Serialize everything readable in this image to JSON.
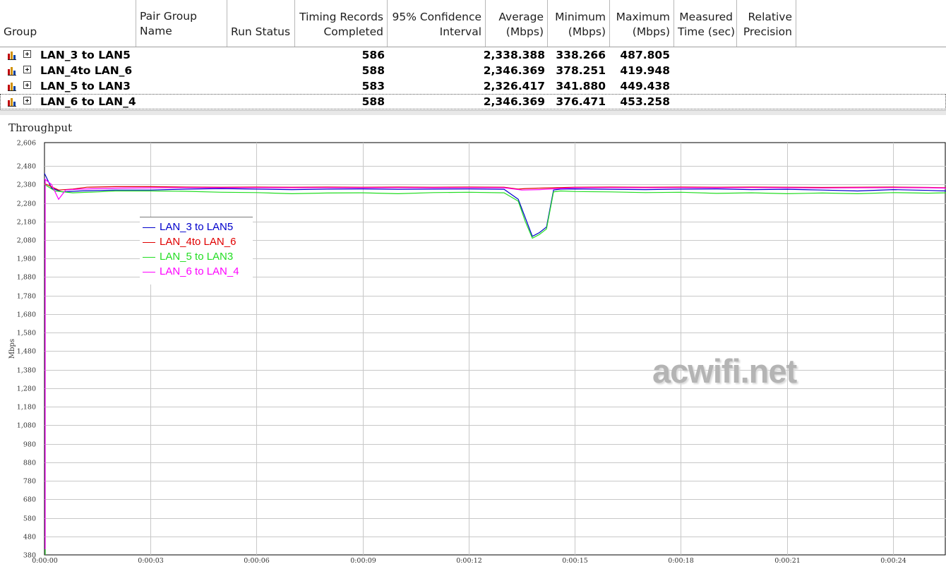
{
  "table": {
    "headers": [
      {
        "key": "group",
        "lines": [
          "Group"
        ]
      },
      {
        "key": "pair_group_name",
        "lines": [
          "Pair Group",
          "Name"
        ]
      },
      {
        "key": "run_status",
        "lines": [
          "Run Status"
        ]
      },
      {
        "key": "timing_records",
        "lines": [
          "Timing Records",
          "Completed"
        ]
      },
      {
        "key": "confidence",
        "lines": [
          "95% Confidence",
          "Interval"
        ]
      },
      {
        "key": "average",
        "lines": [
          "Average",
          "(Mbps)"
        ]
      },
      {
        "key": "minimum",
        "lines": [
          "Minimum",
          "(Mbps)"
        ]
      },
      {
        "key": "maximum",
        "lines": [
          "Maximum",
          "(Mbps)"
        ]
      },
      {
        "key": "measured_time",
        "lines": [
          "Measured",
          "Time (sec)"
        ]
      },
      {
        "key": "relative_precision",
        "lines": [
          "Relative",
          "Precision"
        ]
      }
    ],
    "rows": [
      {
        "group": "LAN_3 to LAN5",
        "records": "586",
        "average": "2,338.388",
        "minimum": "338.266",
        "maximum": "487.805"
      },
      {
        "group": "LAN_4to LAN_6",
        "records": "588",
        "average": "2,346.369",
        "minimum": "378.251",
        "maximum": "419.948"
      },
      {
        "group": "LAN_5 to LAN3",
        "records": "583",
        "average": "2,326.417",
        "minimum": "341.880",
        "maximum": "449.438"
      },
      {
        "group": "LAN_6 to LAN_4",
        "records": "588",
        "average": "2,346.369",
        "minimum": "376.471",
        "maximum": "453.258"
      }
    ]
  },
  "watermark": "acwifi.net",
  "chart_data": {
    "type": "line",
    "title": "Throughput",
    "ylabel": "Mbps",
    "xlabel": "",
    "ylim": [
      380,
      2606
    ],
    "xlim_seconds": [
      0,
      25.5
    ],
    "y_ticks": [
      "2,606",
      "2,480",
      "2,380",
      "2,280",
      "2,180",
      "2,080",
      "1,980",
      "1,880",
      "1,780",
      "1,680",
      "1,580",
      "1,480",
      "1,380",
      "1,280",
      "1,180",
      "1,080",
      "980",
      "880",
      "780",
      "680",
      "580",
      "480",
      "380"
    ],
    "x_ticks": [
      "0:00:00",
      "0:00:03",
      "0:00:06",
      "0:00:09",
      "0:00:12",
      "0:00:15",
      "0:00:18",
      "0:00:21",
      "0:00:24"
    ],
    "grid": true,
    "legend_position": "upper-left",
    "series": [
      {
        "name": "LAN_3 to LAN5",
        "color": "#0000cc",
        "points": [
          [
            0,
            2440
          ],
          [
            0.2,
            2360
          ],
          [
            0.5,
            2340
          ],
          [
            1,
            2345
          ],
          [
            2,
            2350
          ],
          [
            3,
            2350
          ],
          [
            4,
            2355
          ],
          [
            5,
            2358
          ],
          [
            6,
            2355
          ],
          [
            7,
            2352
          ],
          [
            8,
            2355
          ],
          [
            9,
            2356
          ],
          [
            10,
            2354
          ],
          [
            11,
            2355
          ],
          [
            12,
            2356
          ],
          [
            13,
            2354
          ],
          [
            13.4,
            2300
          ],
          [
            13.6,
            2200
          ],
          [
            13.8,
            2100
          ],
          [
            14,
            2120
          ],
          [
            14.2,
            2150
          ],
          [
            14.4,
            2350
          ],
          [
            14.6,
            2355
          ],
          [
            15,
            2356
          ],
          [
            16,
            2354
          ],
          [
            17,
            2352
          ],
          [
            18,
            2355
          ],
          [
            19,
            2356
          ],
          [
            20,
            2352
          ],
          [
            21,
            2354
          ],
          [
            22,
            2350
          ],
          [
            23,
            2345
          ],
          [
            24,
            2352
          ],
          [
            25,
            2348
          ],
          [
            25.5,
            2345
          ]
        ]
      },
      {
        "name": "LAN_4to LAN_6",
        "color": "#e00000",
        "points": [
          [
            0,
            2385
          ],
          [
            0.4,
            2350
          ],
          [
            0.8,
            2355
          ],
          [
            1.2,
            2365
          ],
          [
            2,
            2368
          ],
          [
            3,
            2368
          ],
          [
            4,
            2366
          ],
          [
            5,
            2365
          ],
          [
            6,
            2366
          ],
          [
            7,
            2365
          ],
          [
            8,
            2366
          ],
          [
            9,
            2365
          ],
          [
            10,
            2366
          ],
          [
            11,
            2365
          ],
          [
            12,
            2366
          ],
          [
            13,
            2365
          ],
          [
            13.4,
            2355
          ],
          [
            13.6,
            2358
          ],
          [
            14,
            2360
          ],
          [
            14.4,
            2362
          ],
          [
            15,
            2365
          ],
          [
            16,
            2366
          ],
          [
            17,
            2365
          ],
          [
            18,
            2366
          ],
          [
            19,
            2365
          ],
          [
            20,
            2366
          ],
          [
            21,
            2365
          ],
          [
            22,
            2364
          ],
          [
            23,
            2365
          ],
          [
            24,
            2366
          ],
          [
            25,
            2364
          ],
          [
            25.5,
            2362
          ]
        ]
      },
      {
        "name": "LAN_5 to LAN3",
        "color": "#22dd22",
        "points": [
          [
            0,
            2380
          ],
          [
            0.3,
            2345
          ],
          [
            0.8,
            2335
          ],
          [
            1.5,
            2340
          ],
          [
            2,
            2345
          ],
          [
            3,
            2345
          ],
          [
            4,
            2343
          ],
          [
            5,
            2338
          ],
          [
            6,
            2336
          ],
          [
            7,
            2330
          ],
          [
            8,
            2334
          ],
          [
            9,
            2335
          ],
          [
            10,
            2330
          ],
          [
            11,
            2336
          ],
          [
            12,
            2338
          ],
          [
            13,
            2335
          ],
          [
            13.4,
            2290
          ],
          [
            13.6,
            2180
          ],
          [
            13.8,
            2090
          ],
          [
            14,
            2110
          ],
          [
            14.2,
            2140
          ],
          [
            14.4,
            2340
          ],
          [
            14.6,
            2345
          ],
          [
            15,
            2342
          ],
          [
            16,
            2340
          ],
          [
            17,
            2336
          ],
          [
            18,
            2338
          ],
          [
            19,
            2332
          ],
          [
            20,
            2335
          ],
          [
            21,
            2330
          ],
          [
            22,
            2334
          ],
          [
            23,
            2330
          ],
          [
            24,
            2336
          ],
          [
            25,
            2333
          ],
          [
            25.5,
            2335
          ]
        ]
      },
      {
        "name": "LAN_6 to LAN_4",
        "color": "#ff00ff",
        "points": [
          [
            0,
            2410
          ],
          [
            0.2,
            2380
          ],
          [
            0.4,
            2300
          ],
          [
            0.6,
            2350
          ],
          [
            1,
            2355
          ],
          [
            2,
            2360
          ],
          [
            3,
            2362
          ],
          [
            4,
            2363
          ],
          [
            5,
            2362
          ],
          [
            6,
            2363
          ],
          [
            7,
            2362
          ],
          [
            8,
            2363
          ],
          [
            9,
            2362
          ],
          [
            10,
            2363
          ],
          [
            11,
            2362
          ],
          [
            12,
            2363
          ],
          [
            13,
            2362
          ],
          [
            13.5,
            2350
          ],
          [
            14,
            2352
          ],
          [
            14.5,
            2358
          ],
          [
            15,
            2362
          ],
          [
            16,
            2363
          ],
          [
            17,
            2362
          ],
          [
            18,
            2363
          ],
          [
            19,
            2362
          ],
          [
            20,
            2363
          ],
          [
            21,
            2362
          ],
          [
            22,
            2361
          ],
          [
            23,
            2362
          ],
          [
            24,
            2363
          ],
          [
            25,
            2362
          ],
          [
            25.5,
            2360
          ]
        ]
      }
    ]
  }
}
